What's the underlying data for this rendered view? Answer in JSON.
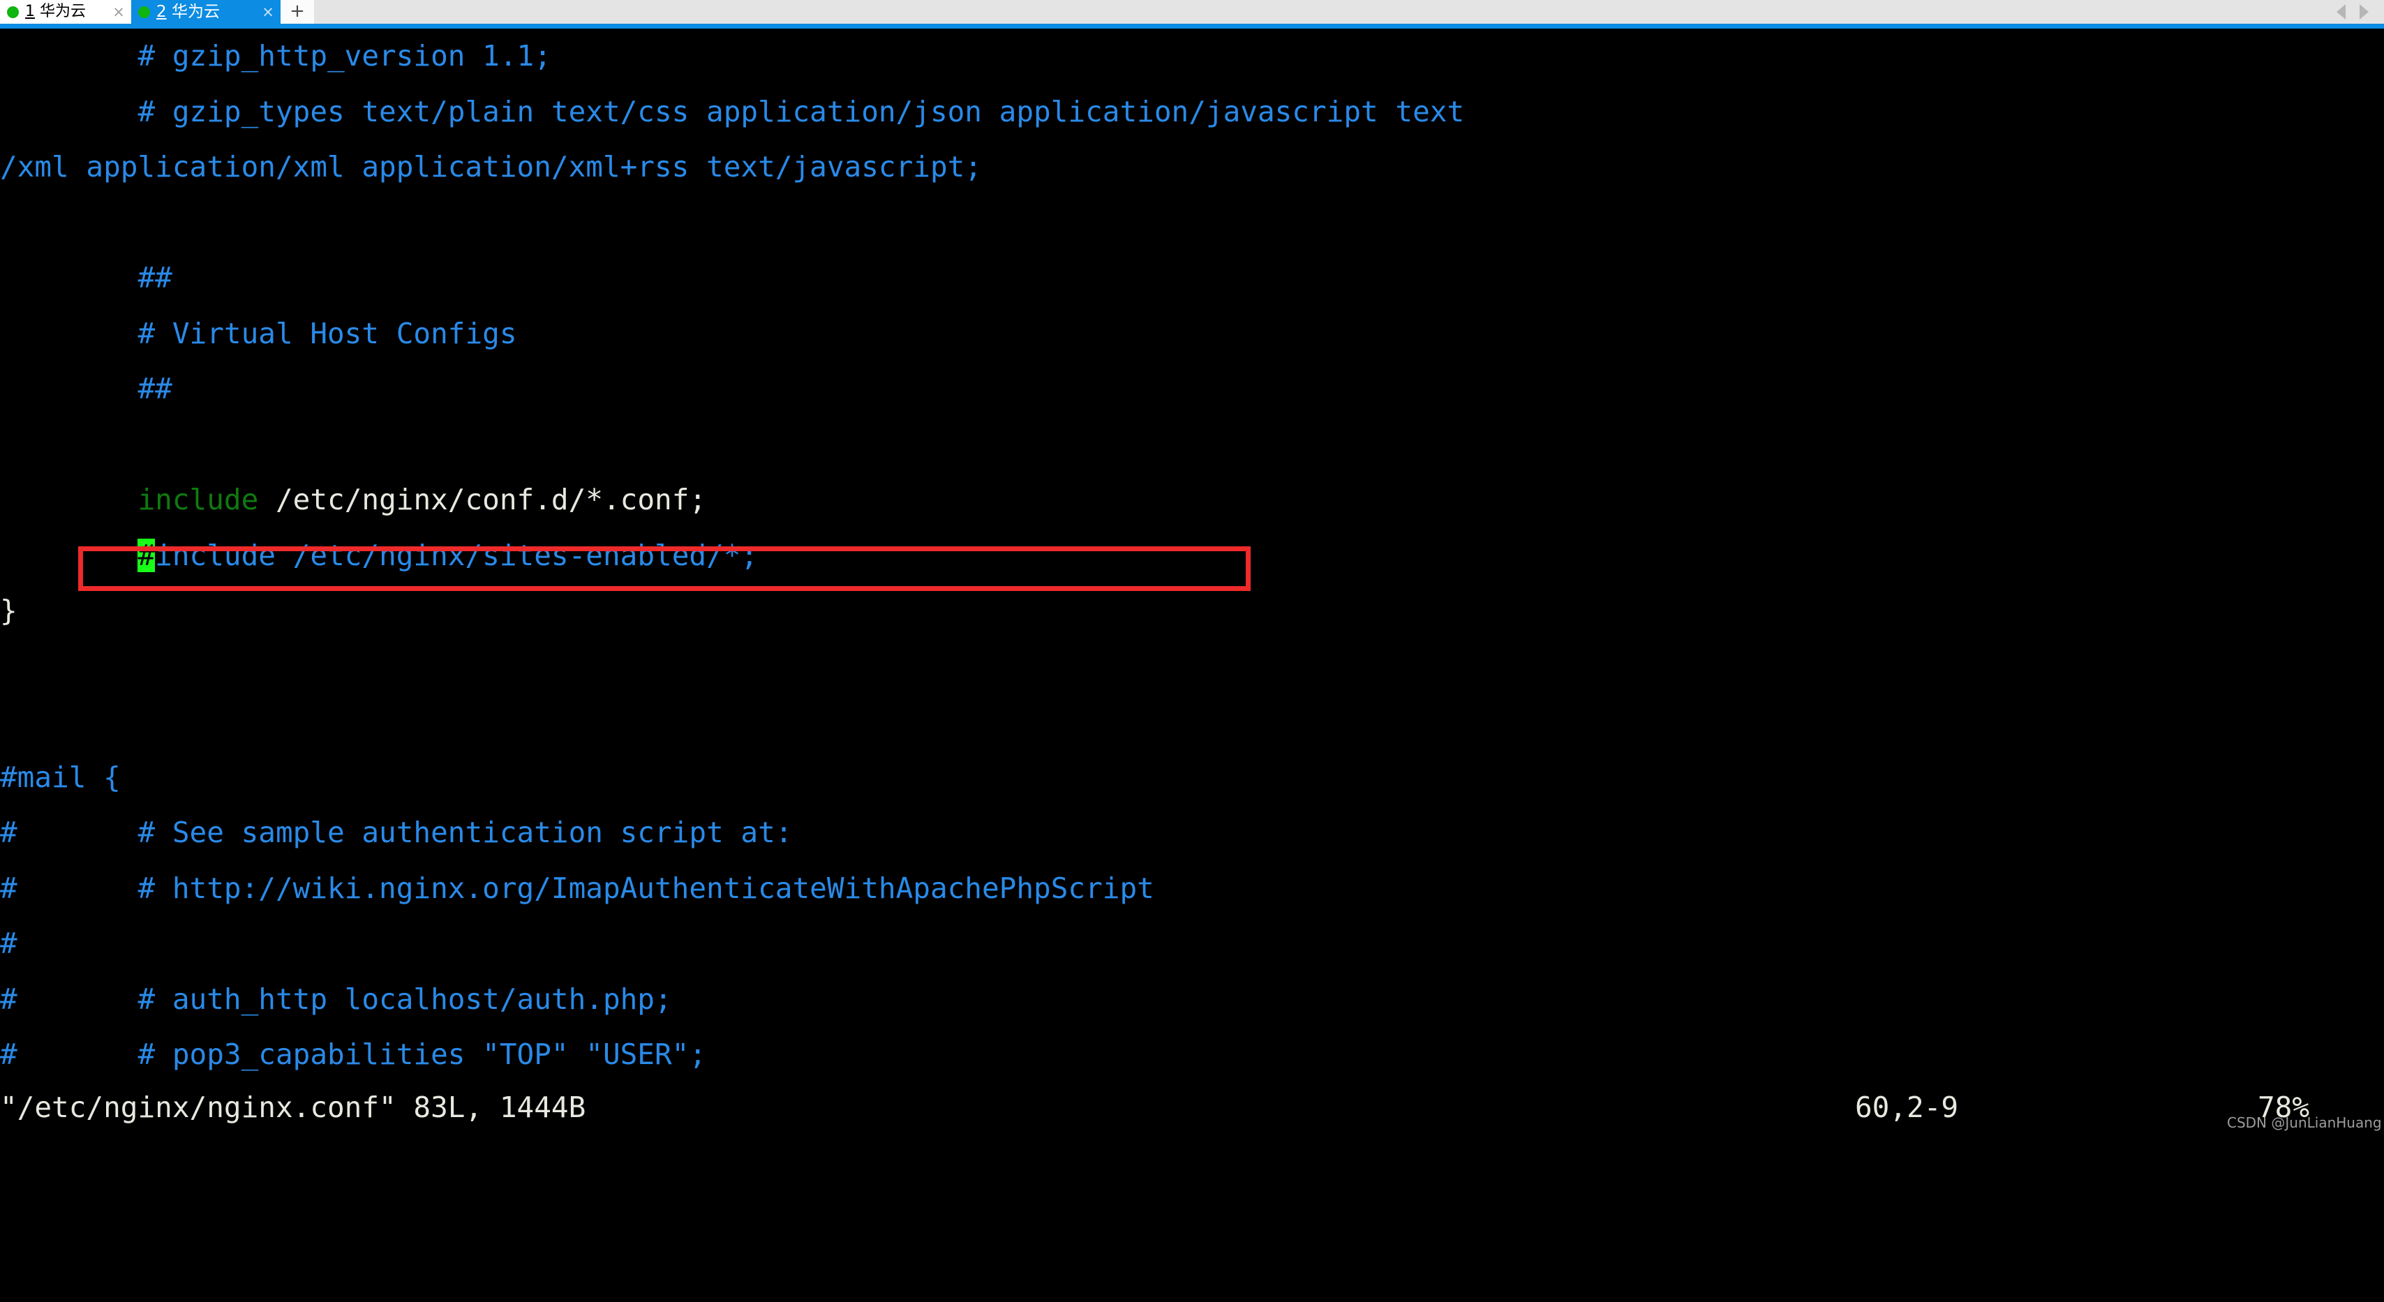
{
  "tabbar": {
    "tabs": [
      {
        "index": "1",
        "title": "华为云",
        "status_dot": "green-dot-icon",
        "close": "×",
        "active": false
      },
      {
        "index": "2",
        "title": "华为云",
        "status_dot": "green-dot-icon",
        "close": "×",
        "active": true
      }
    ],
    "new_tab_label": "+",
    "scroll_left_icon": "chevron-left-icon",
    "scroll_right_icon": "chevron-right-icon",
    "active_tab_color": "#0c8ce2",
    "bar_background": "#e4e4e4"
  },
  "terminal": {
    "background": "#000000",
    "comment_color": "#2a8ae8",
    "keyword_color": "#0f7a0f",
    "text_color": "#e8e8e0",
    "cursor_color": "#19ff19",
    "lines": [
      {
        "segments": [
          {
            "text": "        # gzip_http_version 1.1;",
            "style": "comment"
          }
        ]
      },
      {
        "segments": [
          {
            "text": "        # gzip_types text/plain text/css application/json application/javascript text",
            "style": "comment"
          }
        ]
      },
      {
        "segments": [
          {
            "text": "/xml application/xml application/xml+rss text/javascript;",
            "style": "comment"
          }
        ]
      },
      {
        "segments": [
          {
            "text": "",
            "style": "comment"
          }
        ]
      },
      {
        "segments": [
          {
            "text": "        ##",
            "style": "comment"
          }
        ]
      },
      {
        "segments": [
          {
            "text": "        # Virtual Host Configs",
            "style": "comment"
          }
        ]
      },
      {
        "segments": [
          {
            "text": "        ##",
            "style": "comment"
          }
        ]
      },
      {
        "segments": [
          {
            "text": "",
            "style": "comment"
          }
        ]
      },
      {
        "segments": [
          {
            "text": "        ",
            "style": "normal"
          },
          {
            "text": "include",
            "style": "keyword"
          },
          {
            "text": " /etc/nginx/conf.d/*.conf;",
            "style": "normal"
          }
        ]
      },
      {
        "segments": [
          {
            "text": "        ",
            "style": "normal"
          },
          {
            "text": "#",
            "style": "cursor"
          },
          {
            "text": "include /etc/nginx/sites-enabled/*;",
            "style": "comment"
          }
        ]
      },
      {
        "segments": [
          {
            "text": "}",
            "style": "normal"
          }
        ]
      },
      {
        "segments": [
          {
            "text": "",
            "style": "comment"
          }
        ]
      },
      {
        "segments": [
          {
            "text": "",
            "style": "comment"
          }
        ]
      },
      {
        "segments": [
          {
            "text": "#mail {",
            "style": "comment"
          }
        ]
      },
      {
        "segments": [
          {
            "text": "#       # See sample authentication script at:",
            "style": "comment"
          }
        ]
      },
      {
        "segments": [
          {
            "text": "#       # http://wiki.nginx.org/ImapAuthenticateWithApachePhpScript",
            "style": "comment"
          }
        ]
      },
      {
        "segments": [
          {
            "text": "#",
            "style": "comment"
          }
        ]
      },
      {
        "segments": [
          {
            "text": "#       # auth_http localhost/auth.php;",
            "style": "comment"
          }
        ]
      },
      {
        "segments": [
          {
            "text": "#       # pop3_capabilities \"TOP\" \"USER\";",
            "style": "comment"
          }
        ]
      }
    ],
    "annotation": {
      "shape": "rectangle",
      "color": "#ef2a2a",
      "targets_line": "        #include /etc/nginx/sites-enabled/*;"
    }
  },
  "statusline": {
    "file": "\"/etc/nginx/nginx.conf\" 83L, 1444B",
    "position": "60,2-9",
    "percent": "78%"
  },
  "watermark": "CSDN @JunLianHuang"
}
